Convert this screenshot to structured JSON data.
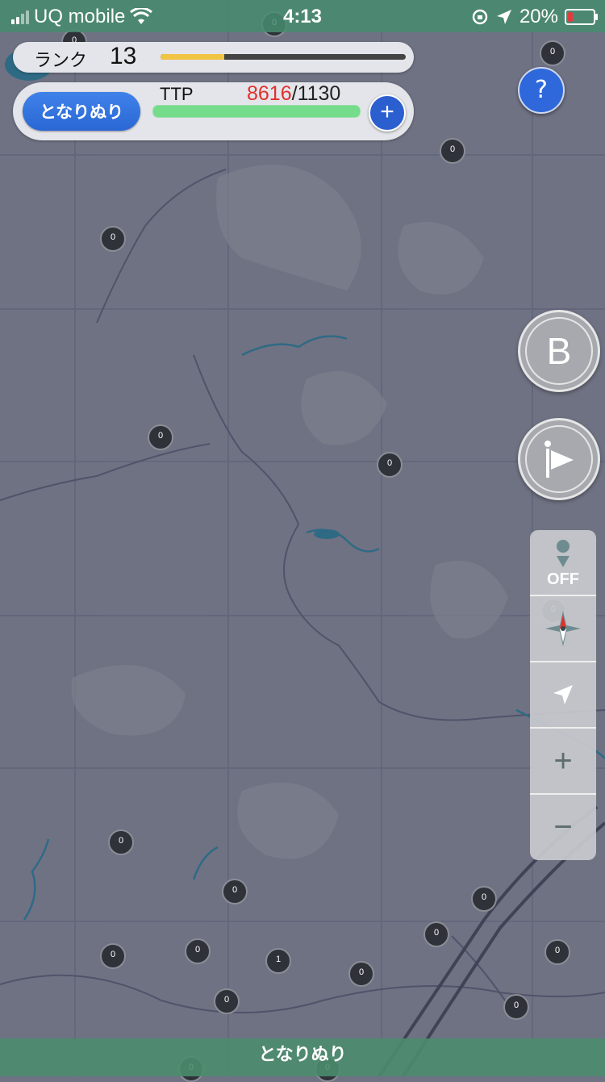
{
  "status_bar": {
    "carrier": "UQ mobile",
    "time": "4:13",
    "battery_percent": "20%",
    "battery_level": 0.2
  },
  "rank": {
    "label": "ランク",
    "value": "13",
    "progress": 0.26
  },
  "ttp": {
    "button_label": "となりぬり",
    "label": "TTP",
    "current": "8616",
    "max": "/1130",
    "progress": 1.0
  },
  "controls": {
    "help": "?",
    "b_button": "B",
    "tracking_label": "OFF",
    "zoom_in": "+",
    "zoom_out": "−"
  },
  "bottom_bar": {
    "label": "となりぬり"
  },
  "markers": [
    "0",
    "0",
    "0",
    "0",
    "0",
    "0",
    "0",
    "0",
    "0",
    "0",
    "0",
    "0",
    "0",
    "1",
    "0",
    "0",
    "0",
    "0",
    "0",
    "0",
    "0"
  ],
  "colors": {
    "map_bg": "#6f7283",
    "accent_blue": "#2e68db",
    "ttp_red": "#e0302a",
    "rank_yellow": "#f2c443",
    "ttp_green": "#74dc8a",
    "status_green": "#468c6e"
  }
}
